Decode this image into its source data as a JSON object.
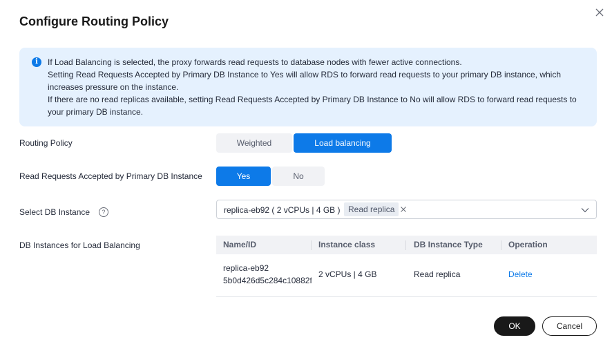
{
  "dialog": {
    "title": "Configure Routing Policy",
    "close_label": "×"
  },
  "notice": {
    "icon": "info-icon",
    "lines": [
      "If Load Balancing is selected, the proxy forwards read requests to database nodes with fewer active connections.",
      "Setting Read Requests Accepted by Primary DB Instance to Yes will allow RDS to forward read requests to your primary DB instance, which increases pressure on the instance.",
      "If there are no read replicas available, setting Read Requests Accepted by Primary DB Instance to No will allow RDS to forward read requests to your primary DB instance."
    ]
  },
  "routing_policy": {
    "label": "Routing Policy",
    "options": [
      "Weighted",
      "Load balancing"
    ],
    "selected": "Load balancing"
  },
  "primary_read": {
    "label": "Read Requests Accepted by Primary DB Instance",
    "options": [
      "Yes",
      "No"
    ],
    "selected": "Yes"
  },
  "select_instance": {
    "label": "Select DB Instance",
    "help": "?",
    "value": "replica-eb92 ( 2 vCPUs | 4 GB )",
    "tag": "Read replica"
  },
  "lb_table": {
    "label": "DB Instances for Load Balancing",
    "columns": [
      "Name/ID",
      "Instance class",
      "DB Instance Type",
      "Operation"
    ],
    "rows": [
      {
        "name": "replica-eb92",
        "id": "5b0d426d5c284c10882f",
        "instance_class": "2 vCPUs | 4 GB",
        "type": "Read replica",
        "operation": "Delete"
      }
    ]
  },
  "footer": {
    "ok": "OK",
    "cancel": "Cancel"
  },
  "colors": {
    "accent": "#0d7ae8",
    "notice_bg": "#e5f1fe",
    "primary_button": "#191919"
  }
}
